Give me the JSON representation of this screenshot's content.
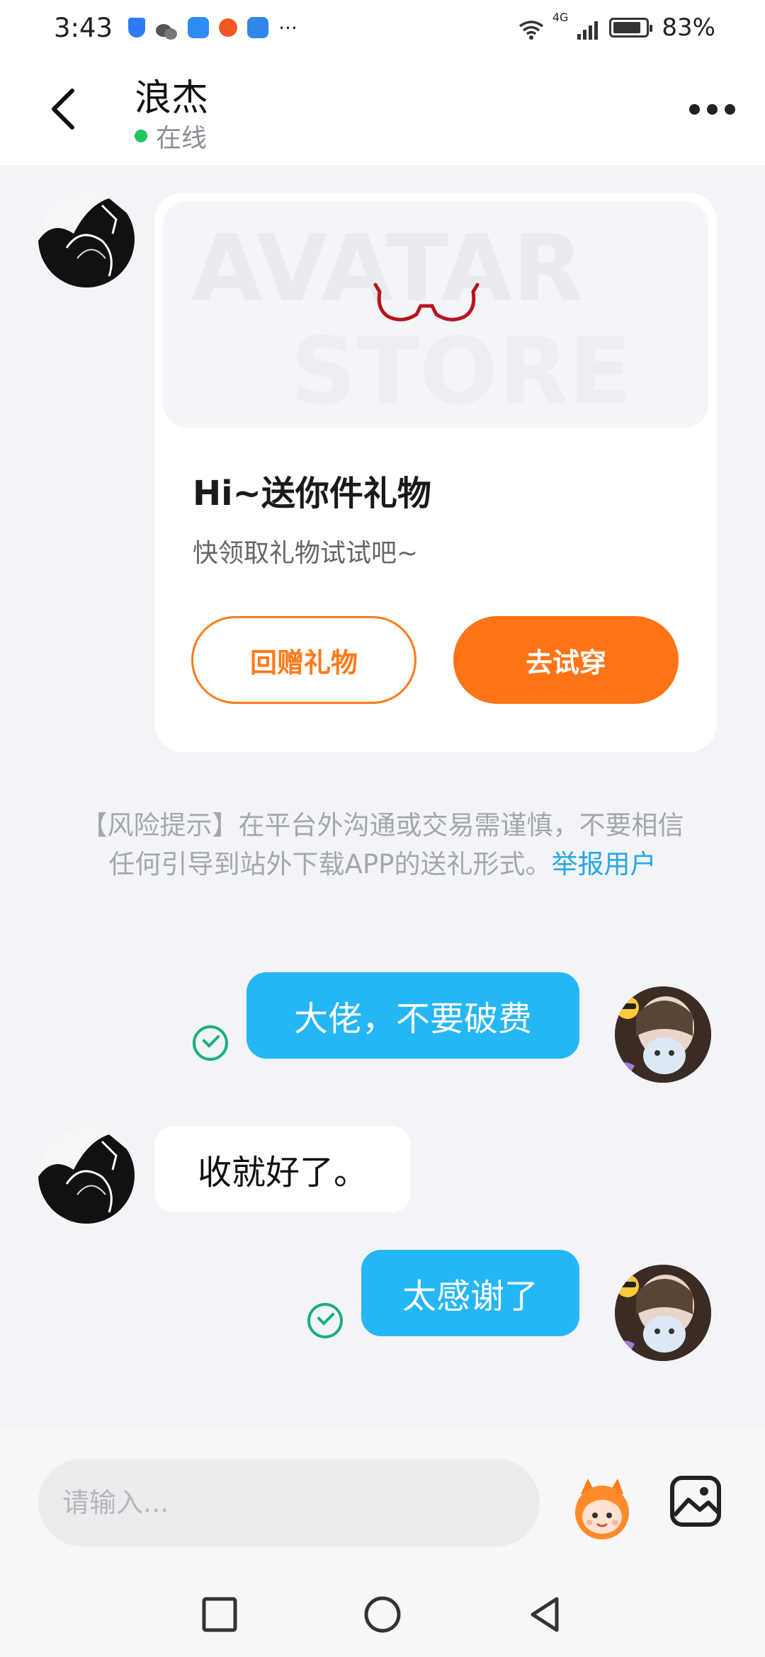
{
  "status_bar": {
    "time": "3:43",
    "more_indicator": "···",
    "network": "4G",
    "battery": "83%"
  },
  "header": {
    "title": "浪杰",
    "presence": "在线"
  },
  "gift_card": {
    "banner_text_1": "AVATAR",
    "banner_text_2": "STORE",
    "title": "Hi~送你件礼物",
    "subtitle": "快领取礼物试试吧~",
    "return_gift_label": "回赠礼物",
    "try_on_label": "去试穿"
  },
  "risk_notice": {
    "text": "【风险提示】在平台外沟通或交易需谨慎，不要相信任何引导到站外下载APP的送礼形式。",
    "link": "举报用户"
  },
  "messages": [
    {
      "sender": "me",
      "text": "大佬，不要破费"
    },
    {
      "sender": "other",
      "text": "收就好了。"
    },
    {
      "sender": "me",
      "text": "太感谢了"
    }
  ],
  "composer": {
    "placeholder": "请输入..."
  },
  "colors": {
    "accent_orange": "#ff7416",
    "bubble_blue": "#25b6f6",
    "link_blue": "#27a7e6",
    "online_green": "#21c45a",
    "read_check_green": "#17b07a"
  },
  "icons": {
    "back": "chevron-left-icon",
    "more": "more-dots-icon",
    "read": "check-circle-icon",
    "emoji": "emoji-mascot-icon",
    "image": "image-icon",
    "nav_recent": "square-icon",
    "nav_home": "circle-icon",
    "nav_back": "triangle-back-icon"
  }
}
